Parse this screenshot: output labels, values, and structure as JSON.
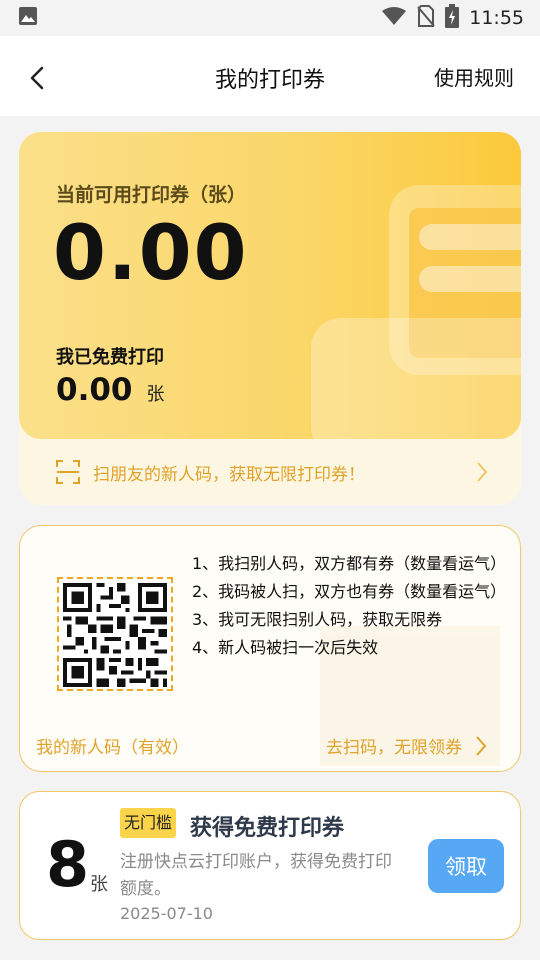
{
  "status_bar": {
    "time": "11:55",
    "icons": [
      "image-icon",
      "wifi-icon",
      "no-sim-icon",
      "battery-charging-icon"
    ]
  },
  "header": {
    "title": "我的打印券",
    "rules_link": "使用规则",
    "back_icon": "chevron-left-icon"
  },
  "balance": {
    "available_label": "当前可用打印券（张）",
    "available_value": "0.00",
    "printed_label": "我已免费打印",
    "printed_value": "0.00",
    "printed_unit": "张",
    "scan_prompt": "扫朋友的新人码，获取无限打印券！"
  },
  "referral": {
    "rules": [
      "1、我扫别人码，双方都有券（数量看运气）",
      "2、我码被人扫，双方也有券（数量看运气）",
      "3、我可无限扫别人码，获取无限券",
      "4、新人码被扫一次后失效"
    ],
    "my_code_label": "我的新人码（有效）",
    "go_scan_label": "去扫码，无限领券"
  },
  "coupon": {
    "count": "8",
    "count_unit": "张",
    "badge": "无门槛",
    "title": "获得免费打印券",
    "description": "注册快点云打印账户，获得免费打印额度。",
    "date": "2025-07-10",
    "claim_label": "领取"
  },
  "colors": {
    "accent_gold": "#e0a32a",
    "card_yellow": "#fbd76a",
    "claim_blue": "#56a8f5",
    "badge_yellow": "#fbd44b"
  }
}
